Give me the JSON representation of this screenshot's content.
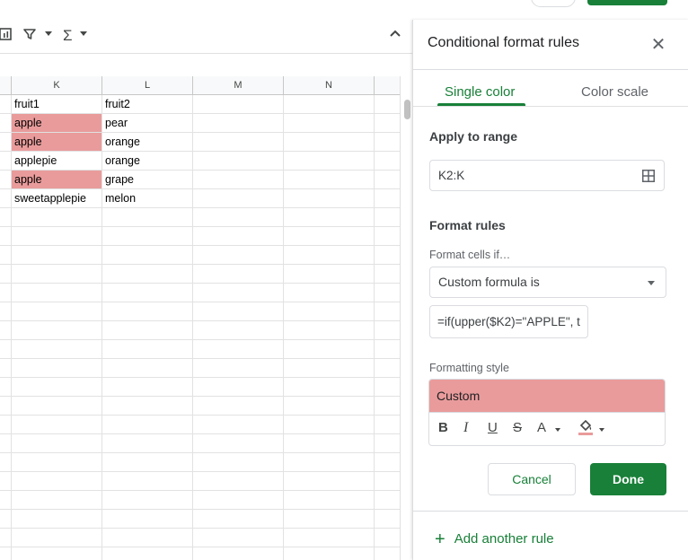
{
  "sheet": {
    "columns": [
      "K",
      "L",
      "M",
      "N"
    ],
    "rows": [
      {
        "k": "fruit1",
        "l": "fruit2",
        "highlight": false
      },
      {
        "k": "apple",
        "l": "pear",
        "highlight": true
      },
      {
        "k": "apple",
        "l": "orange",
        "highlight": true
      },
      {
        "k": "applepie",
        "l": "orange",
        "highlight": false
      },
      {
        "k": "apple",
        "l": "grape",
        "highlight": true
      },
      {
        "k": "sweetapplepie",
        "l": "melon",
        "highlight": false
      }
    ],
    "highlight_color": "#e99b9b"
  },
  "toolbar": {
    "filter_icon": "filter-icon",
    "functions_icon": "sigma-icon",
    "collapse_icon": "chevron-up-icon"
  },
  "panel": {
    "title": "Conditional format rules",
    "tabs": [
      {
        "label": "Single color",
        "active": true
      },
      {
        "label": "Color scale",
        "active": false
      }
    ],
    "apply_to_range_label": "Apply to range",
    "range_value": "K2:K",
    "format_rules_label": "Format rules",
    "format_cells_if_label": "Format cells if…",
    "condition": "Custom formula is",
    "formula_value": "=if(upper($K2)=\"APPLE\", t",
    "formatting_style_label": "Formatting style",
    "style_preview_label": "Custom",
    "format_buttons": {
      "bold": "B",
      "italic": "I",
      "underline": "U",
      "strike": "S",
      "text_color": "A"
    },
    "cancel_label": "Cancel",
    "done_label": "Done",
    "add_rule_label": "Add another rule",
    "accent_color": "#188038",
    "preview_color": "#e99b9b"
  }
}
